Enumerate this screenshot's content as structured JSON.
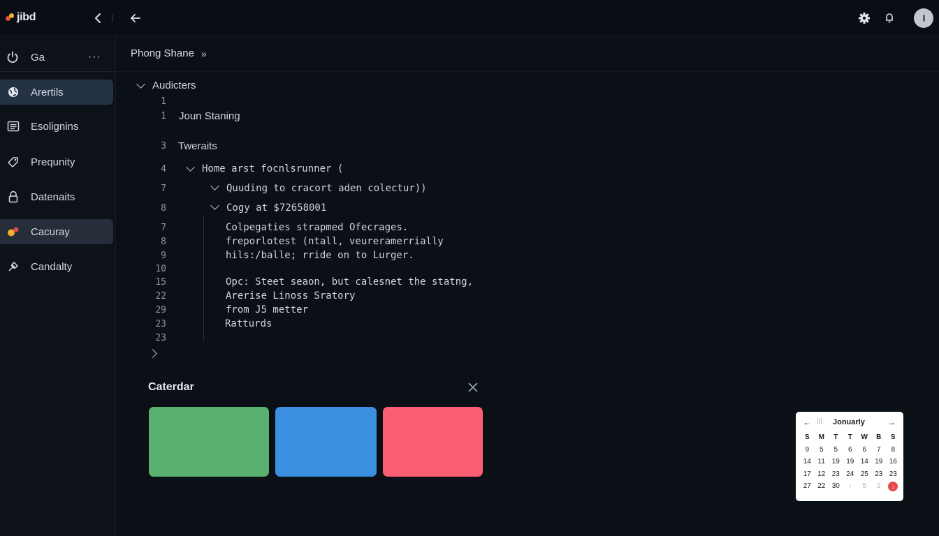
{
  "app": {
    "logo_text": "jibd"
  },
  "sidebar": {
    "header_label": "Ga",
    "more_label": "···",
    "items": [
      {
        "label": "Arertils",
        "icon": "globe-icon"
      },
      {
        "label": "Esolignins",
        "icon": "list-icon"
      },
      {
        "label": "Prequnity",
        "icon": "tag-icon"
      },
      {
        "label": "Datenaits",
        "icon": "lock-icon"
      },
      {
        "label": "Cacuray",
        "icon": "color-dots-icon"
      },
      {
        "label": "Candalty",
        "icon": "puzzle-icon"
      }
    ]
  },
  "breadcrumb": {
    "label": "Phong Shane",
    "chevron": "»"
  },
  "tree": {
    "header": "Audicters",
    "lines": [
      {
        "num": "1",
        "text": ""
      },
      {
        "num": "1",
        "text": "Joun Staning"
      },
      {
        "num": "3",
        "text": "Tweraits"
      },
      {
        "num": "4",
        "text": "Home arst focnlsrunner ("
      },
      {
        "num": "7",
        "text": "Quuding to cracort aden colectur))"
      },
      {
        "num": "8",
        "text": "Cogy at $72658001"
      },
      {
        "num": "7",
        "text": "Colpegaties strapmed Ofecrages."
      },
      {
        "num": "8",
        "text": "freporlotest (ntall, veureramerrially"
      },
      {
        "num": "9",
        "text": "hils:/balle; rride on to Lurger."
      },
      {
        "num": "10",
        "text": ""
      },
      {
        "num": "15",
        "text": "Opc: Steet seaon, but calesnet the statng,"
      },
      {
        "num": "22",
        "text": "Arerise Linoss Sratory"
      },
      {
        "num": "29",
        "text": "from J5 metter"
      },
      {
        "num": "23",
        "text": "Ratturds"
      },
      {
        "num": "23",
        "text": ""
      }
    ]
  },
  "calendar_section": {
    "title": "Caterdar",
    "swatches": [
      {
        "color": "#58b16f"
      },
      {
        "color": "#3a8fe0"
      },
      {
        "color": "#fb5d72"
      }
    ]
  },
  "mini_calendar": {
    "month": "Jonuarly",
    "weekdays": [
      "S",
      "M",
      "T",
      "T",
      "W",
      "B",
      "S"
    ],
    "rows": [
      [
        "9",
        "5",
        "5",
        "6",
        "6",
        "7",
        "8"
      ],
      [
        "14",
        "11",
        "19",
        "19",
        "14",
        "19",
        "16"
      ],
      [
        "17",
        "12",
        "23",
        "24",
        "25",
        "23",
        "23"
      ],
      [
        "27",
        "22",
        "30",
        "›",
        "5",
        "2",
        "↓"
      ]
    ]
  },
  "colors": {
    "accent": "#253246",
    "today": "#e5484d"
  }
}
